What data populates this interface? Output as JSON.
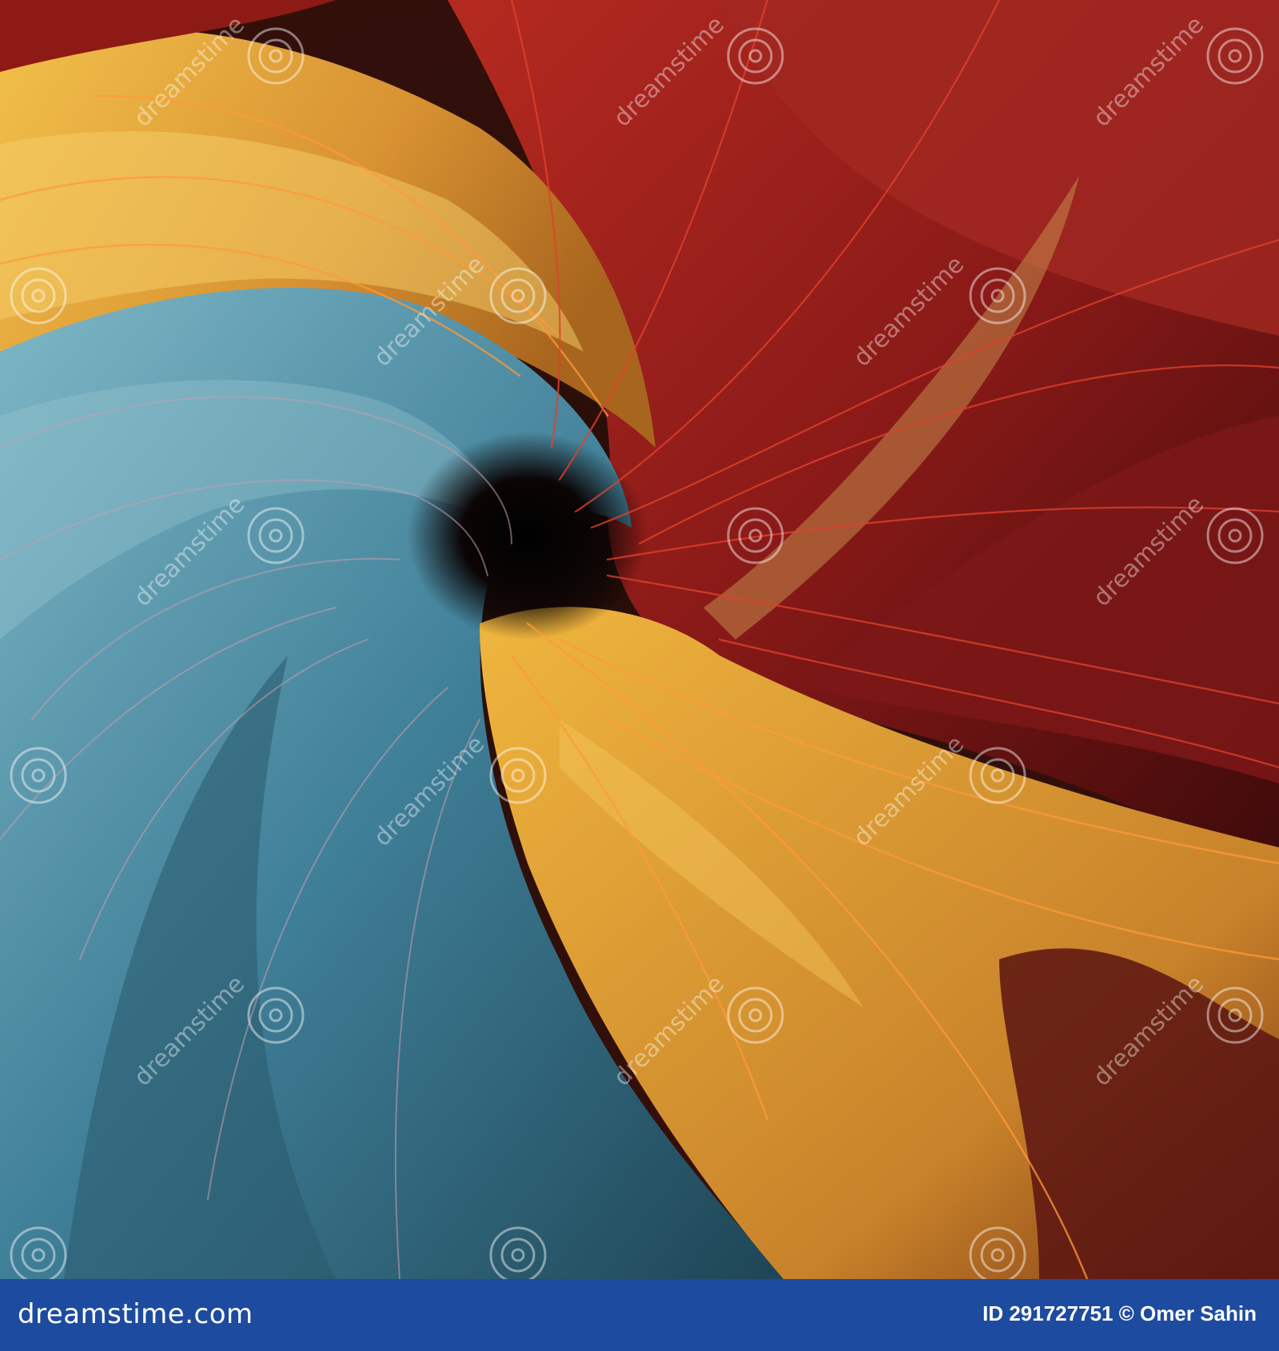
{
  "image": {
    "subject": "abstract swirl of translucent silk fabric with veins",
    "colors": {
      "blue": "#4f8ea4",
      "gold": "#e2a53a",
      "red": "#9c1f1f",
      "center": "#0a0606"
    }
  },
  "watermark": {
    "text": "dreamstime",
    "icon": "spiral-icon"
  },
  "footer": {
    "logo": "dreamstime.com",
    "credit": "ID 291727751 © Omer Sahin",
    "background": "#1d4ba0"
  }
}
